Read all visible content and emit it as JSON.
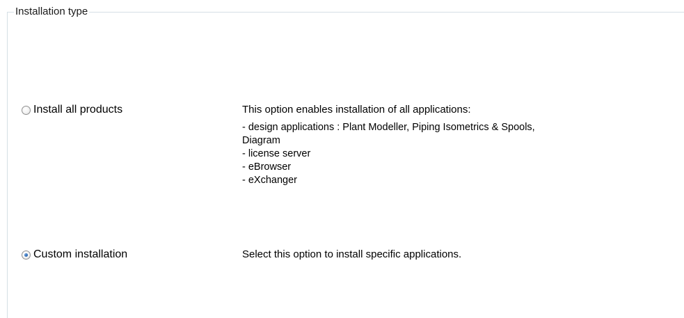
{
  "group": {
    "title": "Installation type"
  },
  "options": [
    {
      "label": "Install all products",
      "selected": false,
      "description": "This option enables installation of all applications:",
      "details": [
        "- design applications : Plant Modeller, Piping Isometrics & Spools,",
        "Diagram",
        "- license server",
        "- eBrowser",
        "- eXchanger"
      ]
    },
    {
      "label": "Custom installation",
      "selected": true,
      "description": "Select this option to install specific applications."
    }
  ]
}
